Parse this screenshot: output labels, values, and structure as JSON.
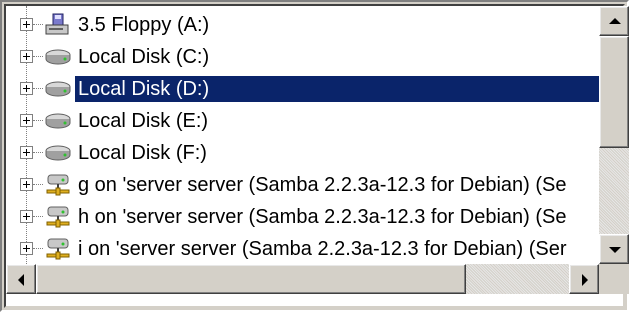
{
  "tree": {
    "items": [
      {
        "label": "3.5 Floppy (A:)",
        "icon": "floppy-drive-icon",
        "selected": false
      },
      {
        "label": "Local Disk (C:)",
        "icon": "hard-disk-icon",
        "selected": false
      },
      {
        "label": "Local Disk (D:)",
        "icon": "hard-disk-icon",
        "selected": true
      },
      {
        "label": "Local Disk (E:)",
        "icon": "hard-disk-icon",
        "selected": false
      },
      {
        "label": "Local Disk (F:)",
        "icon": "hard-disk-icon",
        "selected": false
      },
      {
        "label": "g on 'server server (Samba 2.2.3a-12.3 for Debian) (Se",
        "icon": "network-drive-icon",
        "selected": false
      },
      {
        "label": "h on 'server server (Samba 2.2.3a-12.3 for Debian) (Se",
        "icon": "network-drive-icon",
        "selected": false
      },
      {
        "label": "i on 'server server (Samba 2.2.3a-12.3 for Debian) (Ser",
        "icon": "network-drive-icon",
        "selected": false
      }
    ]
  },
  "colors": {
    "selection_bg": "#0a246a",
    "selection_fg": "#ffffff",
    "chrome": "#d4d0c8"
  },
  "scrollbars": {
    "vertical_thumb_fraction_start": 0.0,
    "vertical_thumb_fraction_size": 0.6,
    "horizontal_thumb_fraction_start": 0.0,
    "horizontal_thumb_fraction_size": 0.85
  }
}
